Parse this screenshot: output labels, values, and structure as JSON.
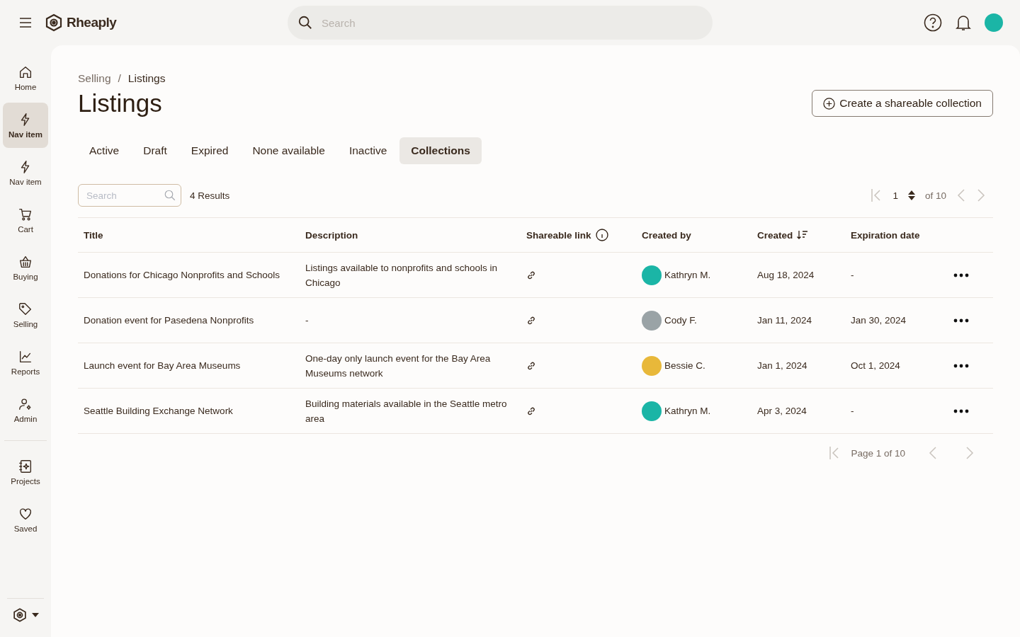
{
  "header": {
    "logo": "Rheaply",
    "search": {
      "placeholder": "Search"
    }
  },
  "sidebar": {
    "items": [
      {
        "label": "Home",
        "selected": false
      },
      {
        "label": "Nav item",
        "selected": true
      },
      {
        "label": "Nav item",
        "selected": false
      },
      {
        "label": "Cart",
        "selected": false
      },
      {
        "label": "Buying",
        "selected": false
      },
      {
        "label": "Selling",
        "selected": false
      },
      {
        "label": "Reports",
        "selected": false
      },
      {
        "label": "Admin",
        "selected": false
      }
    ],
    "secondary": [
      {
        "label": "Projects",
        "selected": false
      },
      {
        "label": "Saved",
        "selected": false
      }
    ]
  },
  "breadcrumb": {
    "items": [
      "Selling",
      "Listings"
    ],
    "separator": "/"
  },
  "title": "Listings",
  "create_button": "Create a shareable collection",
  "tabs": [
    {
      "label": "Active",
      "selected": false
    },
    {
      "label": "Draft",
      "selected": false
    },
    {
      "label": "Expired",
      "selected": false
    },
    {
      "label": "None available",
      "selected": false
    },
    {
      "label": "Inactive",
      "selected": false
    },
    {
      "label": "Collections",
      "selected": true
    }
  ],
  "filter": {
    "placeholder": "Search",
    "results": "4 Results"
  },
  "pager_top": {
    "page": "1",
    "of": "of 10"
  },
  "table": {
    "columns": [
      "Title",
      "Description",
      "Shareable link",
      "Created by",
      "Created",
      "Expiration date"
    ],
    "rows": [
      {
        "title": "Donations for Chicago Nonprofits and Schools",
        "description": "Listings available to nonprofits and schools in Chicago",
        "creator": {
          "name": "Kathryn M.",
          "color": "#1bb5a6"
        },
        "created": "Aug 18, 2024",
        "expiration": "-"
      },
      {
        "title": "Donation event for Pasedena Nonprofits",
        "description": "-",
        "creator": {
          "name": "Cody F.",
          "color": "#9aa3a6"
        },
        "created": "Jan 11, 2024",
        "expiration": "Jan 30, 2024"
      },
      {
        "title": "Launch event for Bay Area Museums",
        "description": "One-day only launch event for the Bay Area Museums network",
        "creator": {
          "name": "Bessie C.",
          "color": "#e8b83a"
        },
        "created": "Jan 1, 2024",
        "expiration": "Oct 1, 2024"
      },
      {
        "title": "Seattle Building Exchange Network",
        "description": "Building materials available in the Seattle metro area",
        "creator": {
          "name": "Kathryn M.",
          "color": "#1bb5a6"
        },
        "created": "Apr 3, 2024",
        "expiration": "-"
      }
    ]
  },
  "pager_bottom": "Page 1 of 10"
}
